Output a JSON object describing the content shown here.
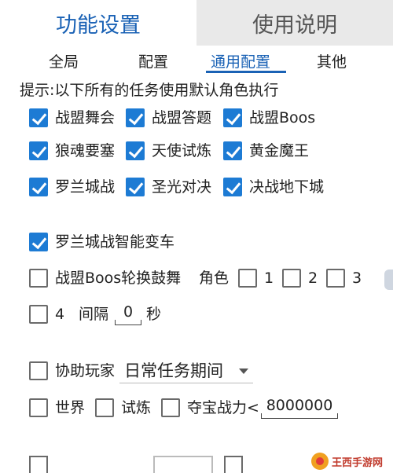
{
  "top_tabs": [
    "功能设置",
    "使用说明"
  ],
  "sub_tabs": [
    "全局",
    "配置",
    "通用配置",
    "其他"
  ],
  "hint": "提示:以下所有的任务使用默认角色执行",
  "tasks": [
    {
      "label": "战盟舞会",
      "checked": true
    },
    {
      "label": "战盟答题",
      "checked": true
    },
    {
      "label": "战盟Boos",
      "checked": true
    },
    {
      "label": "狼魂要塞",
      "checked": true
    },
    {
      "label": "天使试炼",
      "checked": true
    },
    {
      "label": "黄金魔王",
      "checked": true
    },
    {
      "label": "罗兰城战",
      "checked": true
    },
    {
      "label": "圣光对决",
      "checked": true
    },
    {
      "label": "决战地下城",
      "checked": true
    }
  ],
  "smart_car": {
    "label": "罗兰城战智能变车",
    "checked": true
  },
  "boss_rotate": {
    "label": "战盟Boos轮换鼓舞",
    "role_label": "角色",
    "roles": [
      "1",
      "2",
      "3",
      "4"
    ],
    "interval_label": "间隔",
    "interval_value": "0",
    "unit": "秒"
  },
  "assist": {
    "label": "协助玩家",
    "dropdown_value": "日常任务期间"
  },
  "bottom": {
    "world": "世界",
    "trial": "试炼",
    "treasure": "夺宝战力<",
    "power_value": "8000000"
  },
  "watermark": "王西手游网"
}
